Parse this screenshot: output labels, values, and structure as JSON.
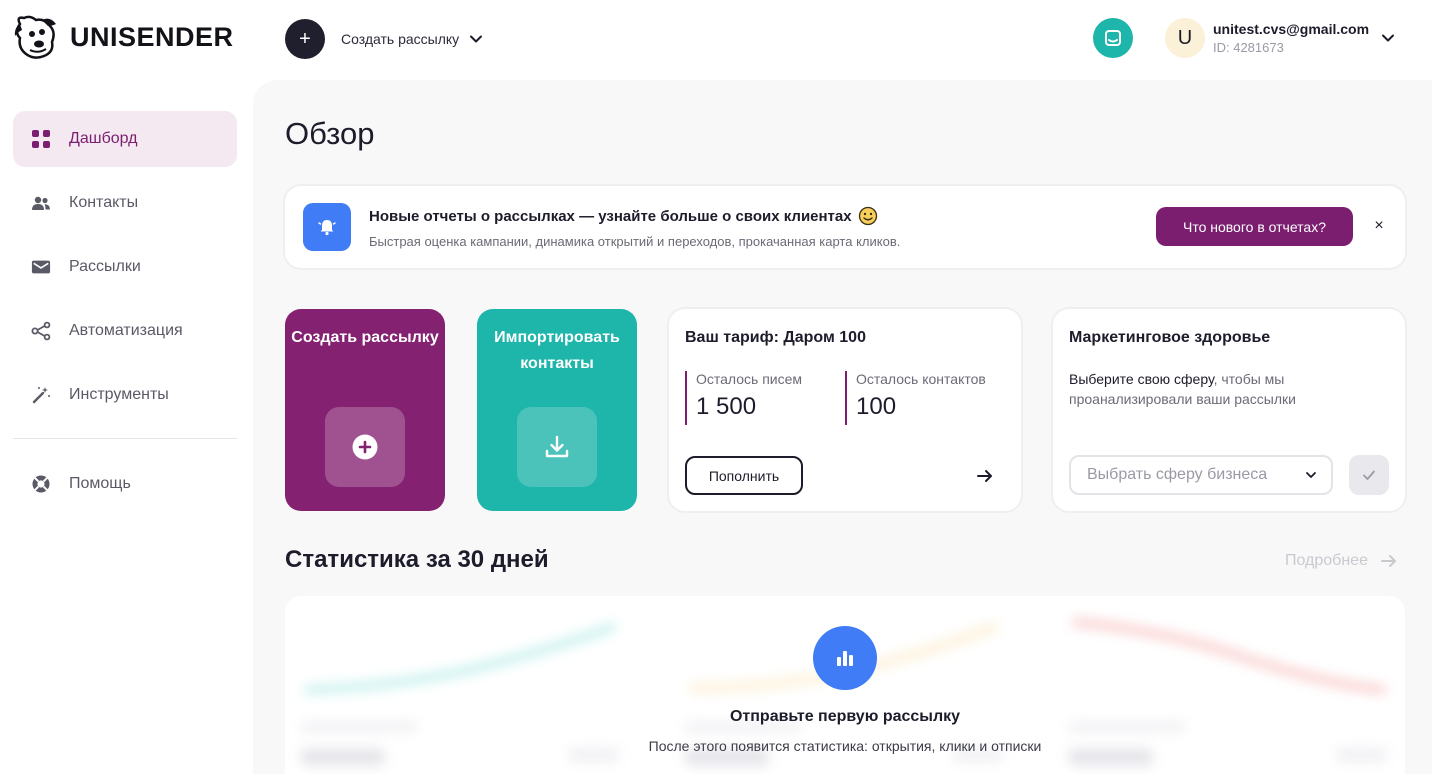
{
  "brand": {
    "name": "UNISENDER"
  },
  "header": {
    "create_label": "Создать рассылку",
    "user_initial": "U",
    "user_email": "unitest.cvs@gmail.com",
    "user_id": "ID: 4281673"
  },
  "sidebar": {
    "items": [
      {
        "label": "Дашборд",
        "icon": "dashboard-icon",
        "active": true
      },
      {
        "label": "Контакты",
        "icon": "contacts-icon"
      },
      {
        "label": "Рассылки",
        "icon": "mail-icon"
      },
      {
        "label": "Автоматизация",
        "icon": "automation-icon"
      },
      {
        "label": "Инструменты",
        "icon": "magic-wand-icon"
      },
      {
        "label": "Помощь",
        "icon": "lifebuoy-icon"
      }
    ]
  },
  "main": {
    "title": "Обзор",
    "notice": {
      "title": "Новые отчеты о рассылках — узнайте больше о своих клиентах",
      "subtitle": "Быстрая оценка кампании, динамика открытий и переходов, прокачанная карта кликов.",
      "button": "Что нового в отчетах?",
      "close": "×"
    },
    "tiles": {
      "create": "Создать рассылку",
      "import": "Импортировать контакты"
    },
    "plan": {
      "title": "Ваш тариф: Даром 100",
      "letters_label": "Осталось писем",
      "letters_value": "1 500",
      "contacts_label": "Осталось контактов",
      "contacts_value": "100",
      "topup": "Пополнить"
    },
    "health": {
      "title": "Маркетинговое здоровье",
      "text_dark": "Выберите свою сферу",
      "text_rest": ", чтобы мы проанализировали ваши рассылки",
      "select_placeholder": "Выбрать сферу бизнеса"
    },
    "stats": {
      "title": "Статистика за 30 дней",
      "more": "Подробнее",
      "empty_title": "Отправьте первую рассылку",
      "empty_sub": "После этого появится статистика: открытия, клики и отписки"
    }
  },
  "colors": {
    "brand_purple": "#852171",
    "teal": "#1eb5aa",
    "blue": "#3f7cf6",
    "dark": "#1f1f2d"
  }
}
